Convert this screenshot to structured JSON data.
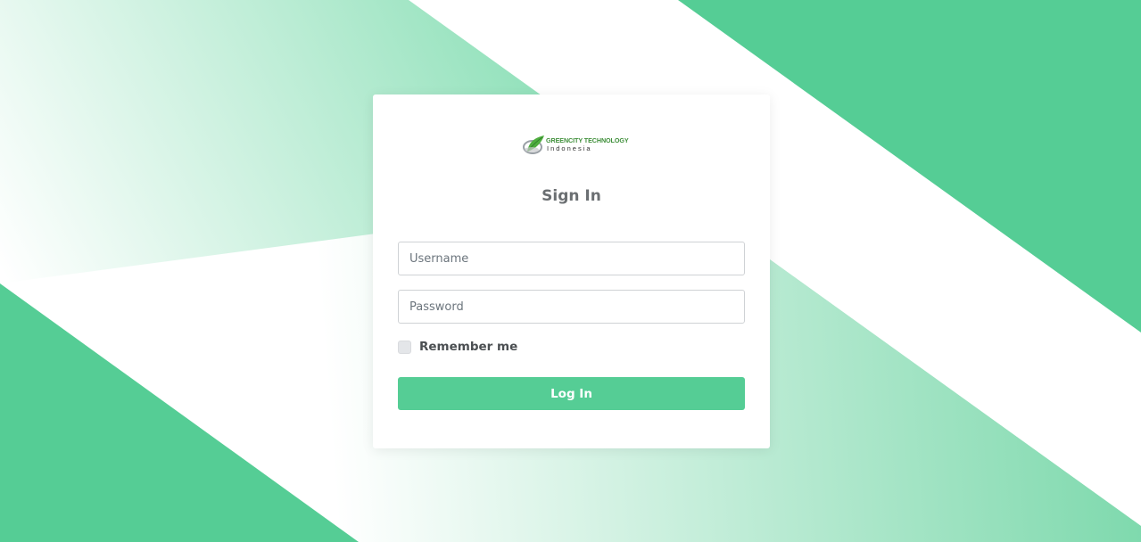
{
  "colors": {
    "accent": "#55cd95",
    "card_bg": "#ffffff",
    "title_color": "#6b6f72"
  },
  "logo": {
    "brand_text": "GREENCITY TECHNOLOGY",
    "sub_text": "Indonesia",
    "icon": "leaf-globe-icon"
  },
  "login": {
    "title": "Sign In",
    "username_placeholder": "Username",
    "password_placeholder": "Password",
    "remember_label": "Remember me",
    "remember_checked": false,
    "submit_label": "Log In"
  }
}
